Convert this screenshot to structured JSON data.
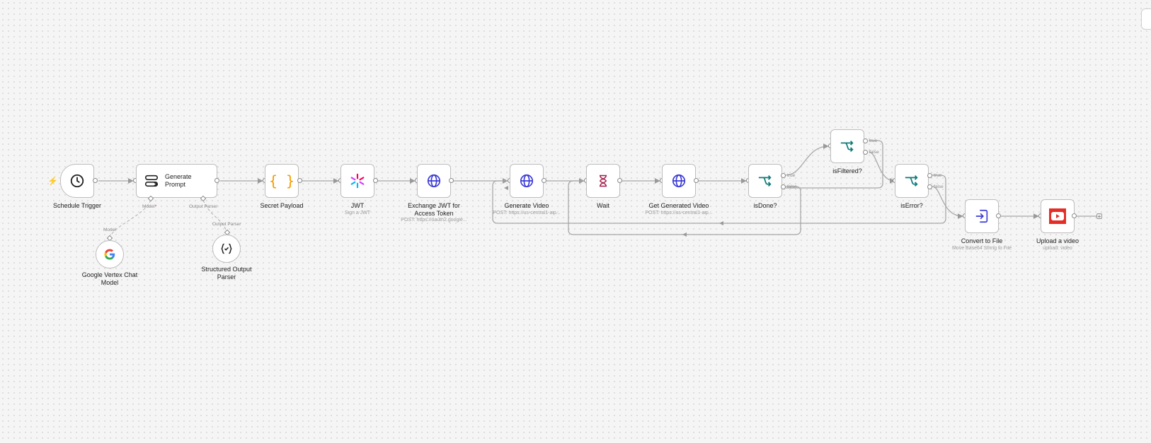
{
  "nodes": {
    "schedule_trigger": {
      "label": "Schedule Trigger"
    },
    "generate_prompt": {
      "label": "Generate Prompt",
      "port_model": "Model",
      "port_parser": "Output Parser"
    },
    "vertex_model": {
      "label": "Google Vertex Chat Model",
      "port": "Model"
    },
    "output_parser": {
      "label": "Structured Output Parser",
      "port": "Output Parser"
    },
    "secret_payload": {
      "label": "Secret Payload"
    },
    "jwt": {
      "label": "JWT",
      "sub": "Sign a JWT"
    },
    "exchange_jwt": {
      "label": "Exchange JWT for Access Token",
      "sub": "POST: https://oauth2.google..."
    },
    "generate_video": {
      "label": "Generate Video",
      "sub": "POST: https://us-central1-aip..."
    },
    "wait": {
      "label": "Wait"
    },
    "get_video": {
      "label": "Get Generated Video",
      "sub": "POST: https://us-central1-aip..."
    },
    "is_done": {
      "label": "isDone?",
      "true_label": "true",
      "false_label": "false"
    },
    "is_filtered": {
      "label": "isFiltered?",
      "true_label": "true",
      "false_label": "false"
    },
    "is_error": {
      "label": "isError?",
      "true_label": "true",
      "false_label": "false"
    },
    "convert_file": {
      "label": "Convert to File",
      "sub": "Move Base64 String to File"
    },
    "upload_video": {
      "label": "Upload a video",
      "sub": "upload: video"
    }
  },
  "add_button": "+",
  "colors": {
    "trigger_bolt": "#ff6d1a",
    "http": "#3b3bd6",
    "if": "#117a7a",
    "youtube": "#e52d27",
    "code": "#f59c00",
    "wait": "#a51b4b"
  },
  "icons": {
    "schedule_trigger": "clock-icon",
    "generate_prompt": "chain-icon",
    "vertex_model": "google-icon",
    "output_parser": "braces-check-icon",
    "secret_payload": "braces-icon",
    "jwt": "jwt-icon",
    "http": "globe-icon",
    "wait": "hourglass-icon",
    "if": "branch-icon",
    "convert_file": "file-import-icon",
    "upload_video": "youtube-icon"
  }
}
